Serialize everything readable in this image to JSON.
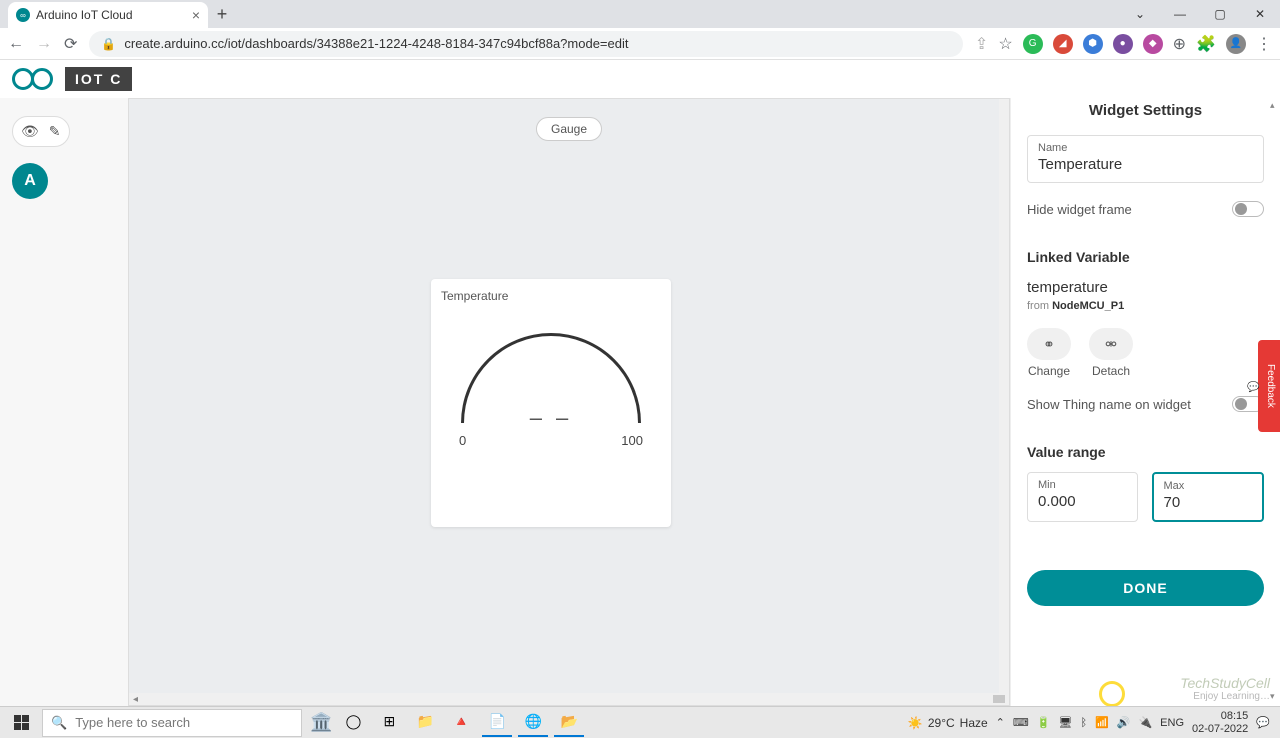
{
  "browser": {
    "tab_title": "Arduino IoT Cloud",
    "url": "create.arduino.cc/iot/dashboards/34388e21-1224-4248-8184-347c94bcf88a?mode=edit"
  },
  "app": {
    "logo_text": "IOT C",
    "canvas_badge": "Gauge"
  },
  "widget": {
    "title": "Temperature",
    "gauge_value": "– –",
    "gauge_min": "0",
    "gauge_max": "100"
  },
  "settings": {
    "header": "Widget Settings",
    "name_label": "Name",
    "name_value": "Temperature",
    "hide_frame_label": "Hide widget frame",
    "linked_var_header": "Linked Variable",
    "linked_var_name": "temperature",
    "linked_from_prefix": "from ",
    "linked_thing": "NodeMCU_P1",
    "change_label": "Change",
    "detach_label": "Detach",
    "show_thing_label": "Show Thing name on widget",
    "value_range_header": "Value range",
    "min_label": "Min",
    "min_value": "0.000",
    "max_label": "Max",
    "max_value": "70",
    "done_label": "DONE"
  },
  "feedback": "Feedback",
  "taskbar": {
    "search_placeholder": "Type here to search",
    "weather_temp": "29°C",
    "weather_cond": "Haze",
    "lang": "ENG",
    "time": "08:15",
    "date": "02-07-2022"
  },
  "watermark": {
    "brand": "TechStudyCell",
    "tag": "Enjoy Learning…"
  }
}
